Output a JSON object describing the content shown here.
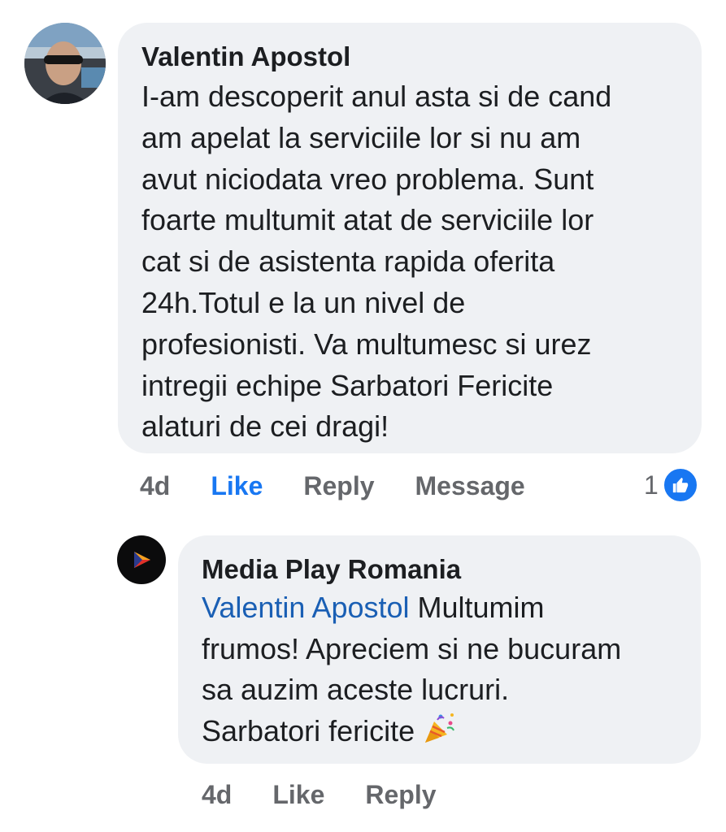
{
  "comment": {
    "author": "Valentin Apostol",
    "text": "I-am descoperit anul asta si de cand\nam apelat la serviciile lor si nu am\navut niciodata vreo problema. Sunt\nfoarte multumit atat de serviciile lor\ncat si de asistenta rapida oferita\n24h.Totul e la un nivel de\nprofesionisti. Va multumesc  si urez\nintregii echipe Sarbatori Fericite\nalaturi de cei dragi!",
    "time": "4d",
    "like_label": "Like",
    "reply_label": "Reply",
    "message_label": "Message",
    "reaction_count": "1",
    "reaction_icon": "thumbs-up-icon",
    "like_color": "#1877f2"
  },
  "reply": {
    "author": "Media Play Romania",
    "mention": "Valentin Apostol",
    "text_line1": " Multumim",
    "text_line2": "frumos! Apreciem si ne bucuram",
    "text_line3": "sa auzim aceste lucruri.",
    "text_line4": "Sarbatori fericite ",
    "emoji_icon": "party-popper-icon",
    "time": "4d",
    "like_label": "Like",
    "reply_label": "Reply",
    "mention_color": "#1a5fb4"
  },
  "colors": {
    "bubble_bg": "#eff1f4",
    "text": "#1c1e21",
    "meta": "#65676b"
  }
}
